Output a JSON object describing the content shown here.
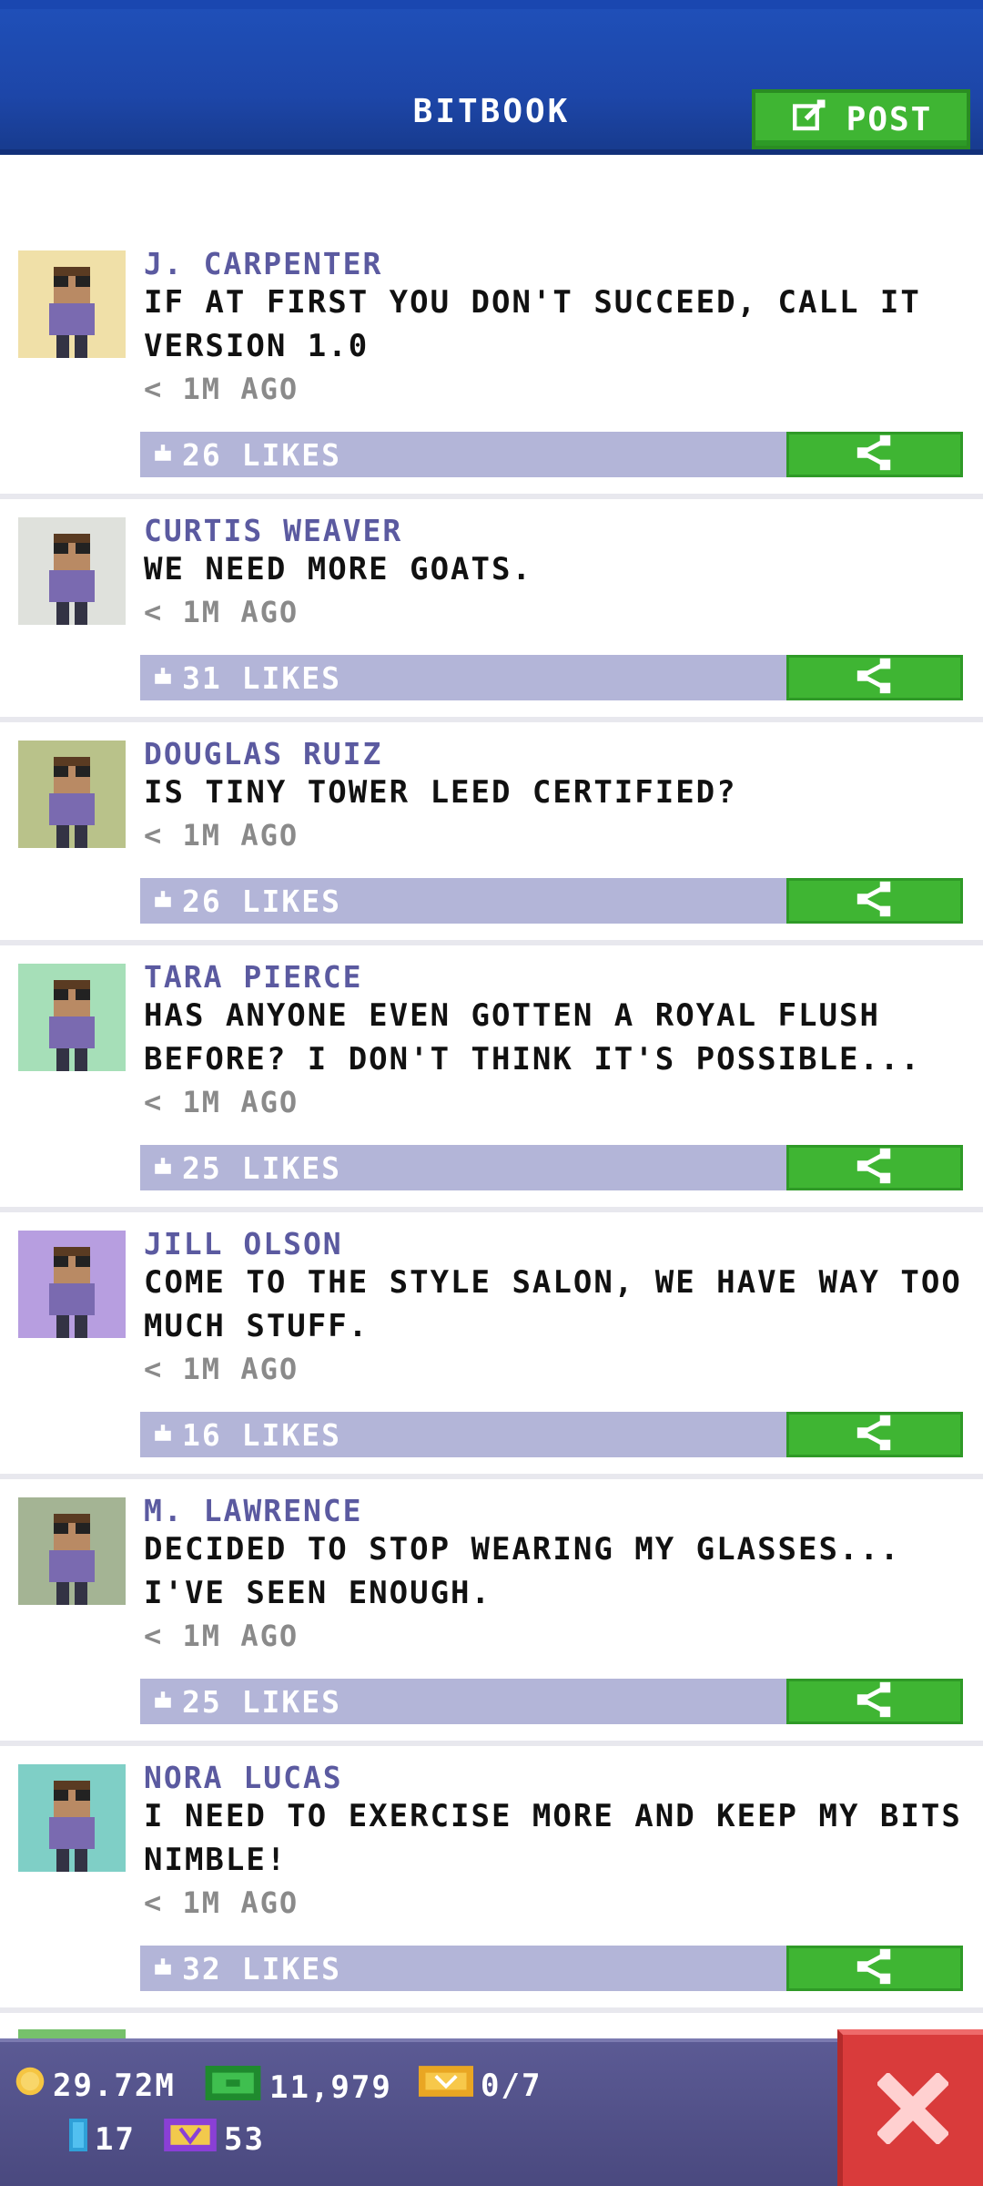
{
  "header": {
    "title": "BITBOOK",
    "post_label": "POST"
  },
  "posts": [
    {
      "name": "J. CARPENTER",
      "message": "IF AT FIRST YOU DON'T SUCCEED, CALL IT VERSION 1.0",
      "time": "< 1M AGO",
      "likes": "26 LIKES",
      "avatar_bg": "#f0e0a8"
    },
    {
      "name": "CURTIS WEAVER",
      "message": "WE NEED MORE GOATS.",
      "time": "< 1M AGO",
      "likes": "31 LIKES",
      "avatar_bg": "#dfe1dc"
    },
    {
      "name": "DOUGLAS RUIZ",
      "message": "IS TINY TOWER LEED CERTIFIED?",
      "time": "< 1M AGO",
      "likes": "26 LIKES",
      "avatar_bg": "#b9c28a"
    },
    {
      "name": "TARA PIERCE",
      "message": "HAS ANYONE EVEN GOTTEN A ROYAL FLUSH BEFORE? I DON'T THINK IT'S POSSIBLE...",
      "time": "< 1M AGO",
      "likes": "25 LIKES",
      "avatar_bg": "#a6dfb8"
    },
    {
      "name": "JILL OLSON",
      "message": "COME TO THE STYLE SALON, WE HAVE WAY TOO MUCH STUFF.",
      "time": "< 1M AGO",
      "likes": "16 LIKES",
      "avatar_bg": "#b79ee0"
    },
    {
      "name": "M. LAWRENCE",
      "message": "DECIDED TO STOP WEARING MY GLASSES... I'VE SEEN ENOUGH.",
      "time": "< 1M AGO",
      "likes": "25 LIKES",
      "avatar_bg": "#a4b494"
    },
    {
      "name": "NORA LUCAS",
      "message": "I NEED TO EXERCISE MORE AND KEEP MY BITS NIMBLE!",
      "time": "< 1M AGO",
      "likes": "32 LIKES",
      "avatar_bg": "#7fcfc6"
    }
  ],
  "status": {
    "coins": "29.72M",
    "bux": "11,979",
    "tickets": "0/7",
    "level": "17",
    "vip": "53"
  },
  "colors": {
    "header_blue": "#1f4fb8",
    "accent_green": "#3fb533",
    "name_purple": "#5b5aa0",
    "like_bar": "#b3b5d8",
    "close_red": "#d93b3b"
  },
  "icons": {
    "post": "edit-icon",
    "share": "share-icon",
    "like": "thumb-icon",
    "close": "close-icon",
    "coin": "coin-icon",
    "bux": "bux-icon",
    "ticket": "ticket-icon",
    "level": "level-icon",
    "vip": "vip-icon"
  }
}
